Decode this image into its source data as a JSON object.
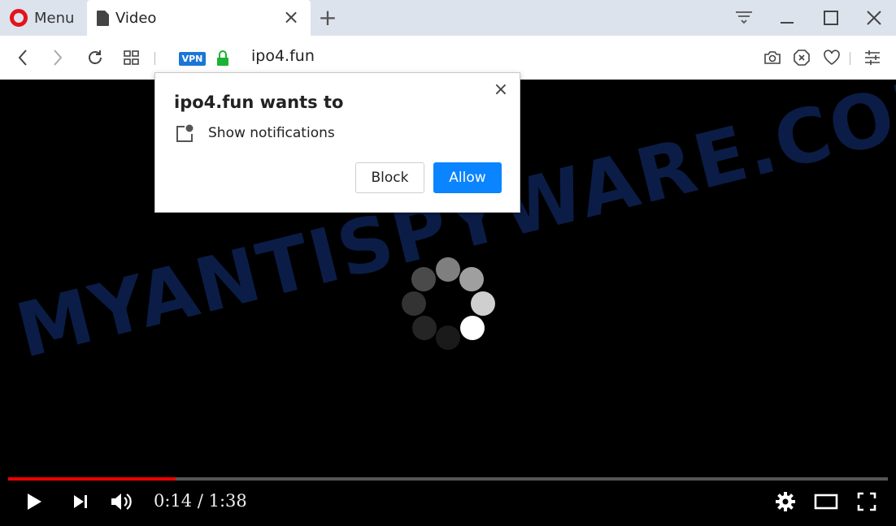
{
  "browser": {
    "menu_label": "Menu",
    "tab_title": "Video",
    "url": "ipo4.fun",
    "vpn_label": "VPN"
  },
  "popup": {
    "title": "ipo4.fun wants to",
    "permission": "Show notifications",
    "block_label": "Block",
    "allow_label": "Allow"
  },
  "video": {
    "watermark": "MYANTISPYWARE.COM",
    "time_current": "0:14",
    "time_separator": " / ",
    "time_total": "1:38",
    "progress_fraction": 0.19
  },
  "colors": {
    "accent": "#0a84ff",
    "progress": "#e00000",
    "opera_red": "#e3141b",
    "vpn_blue": "#1c76d6",
    "lock_green": "#1db233",
    "tabstrip": "#dde3ec"
  }
}
